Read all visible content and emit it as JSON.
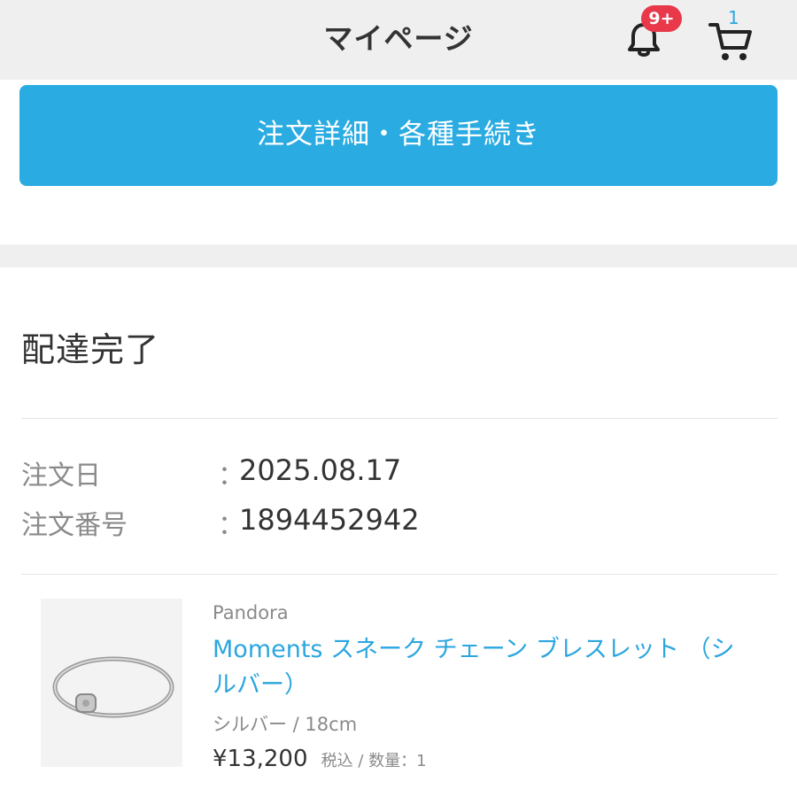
{
  "header": {
    "title": "マイページ",
    "notification_badge": "9+",
    "cart_count": "1",
    "bell_icon": "bell-icon",
    "cart_icon": "cart-icon"
  },
  "action_button": {
    "label": "注文詳細・各種手続き"
  },
  "order": {
    "status": "配達完了",
    "fields": [
      {
        "label": "注文日",
        "colon": "：",
        "value": "2025.08.17"
      },
      {
        "label": "注文番号",
        "colon": "：",
        "value": "1894452942"
      }
    ]
  },
  "product": {
    "brand": "Pandora",
    "name": "Moments スネーク チェーン ブレスレット （シルバー）",
    "variant": "シルバー / 18cm",
    "price": "¥13,200",
    "tax_qty": "税込 / 数量：1",
    "image_icon": "bracelet-image"
  },
  "colors": {
    "accent": "#2aabe2",
    "badge": "#e8384a",
    "header_bg": "#efefef"
  }
}
